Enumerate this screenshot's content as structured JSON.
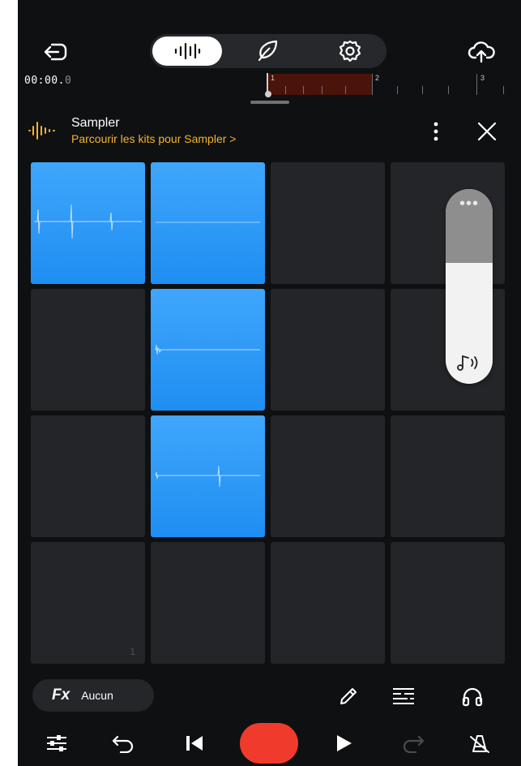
{
  "header": {
    "back_icon": "exit-arrow-icon",
    "upload_icon": "cloud-upload-icon",
    "modes": [
      {
        "name": "waveform-icon",
        "selected": true
      },
      {
        "name": "feather-icon",
        "selected": false
      },
      {
        "name": "gear-icon",
        "selected": false
      }
    ]
  },
  "timeline": {
    "time_main": "00:00.",
    "time_fraction": "0",
    "bar_numbers": [
      "1",
      "2",
      "3"
    ],
    "region_color": "#4a140a"
  },
  "instrument": {
    "name": "Sampler",
    "browse_link": "Parcourir les kits pour Sampler >",
    "accent": "#f4b52a"
  },
  "pads": {
    "active_color": "#2196f3",
    "inactive_color": "#232528",
    "rows": [
      [
        true,
        true,
        false,
        false
      ],
      [
        false,
        true,
        false,
        false
      ],
      [
        false,
        true,
        false,
        false
      ],
      [
        false,
        false,
        false,
        false
      ]
    ],
    "corner_number": "1"
  },
  "volume": {
    "level": 0.62,
    "dots": "•••",
    "icon": "note-volume-icon"
  },
  "fx": {
    "label": "Fx",
    "value": "Aucun"
  },
  "toolbar": {
    "icons": [
      "pencil-icon",
      "lines-list-icon",
      "headphones-icon"
    ]
  },
  "transport": {
    "icons": [
      "mixer-sliders-icon",
      "undo-icon",
      "skip-back-icon",
      "record-button",
      "play-icon",
      "redo-icon",
      "metronome-off-icon"
    ],
    "record_color": "#f03b2c"
  }
}
